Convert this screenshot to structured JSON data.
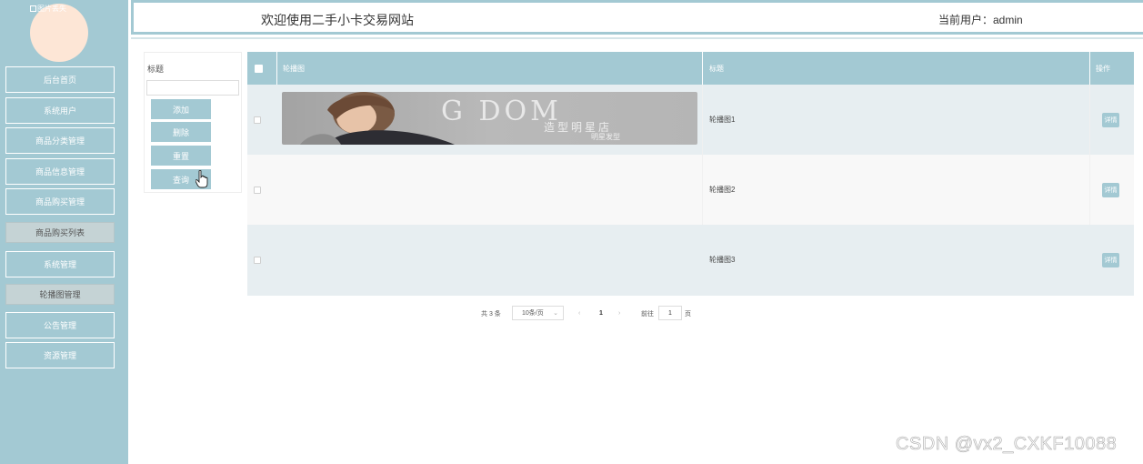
{
  "sidebar": {
    "avatar_alt": "图片丢失",
    "items": [
      {
        "label": "后台首页"
      },
      {
        "label": "系统用户"
      },
      {
        "label": "商品分类管理"
      },
      {
        "label": "商品信息管理"
      },
      {
        "label": "商品购买管理"
      },
      {
        "label": "商品购买列表"
      },
      {
        "label": "系统管理"
      },
      {
        "label": "轮播图管理"
      },
      {
        "label": "公告管理"
      },
      {
        "label": "资源管理"
      }
    ]
  },
  "header": {
    "title": "欢迎使用二手小卡交易网站",
    "current_user": "当前用户：admin"
  },
  "search": {
    "label": "标题",
    "placeholder": "",
    "buttons": {
      "add": "添加",
      "delete": "删除",
      "reset": "重置",
      "query": "查询"
    }
  },
  "table": {
    "columns": [
      "轮播图",
      "标题",
      "操作"
    ],
    "rows": [
      {
        "title": "轮播图1",
        "action": "详情"
      },
      {
        "title": "轮播图2",
        "action": "详情"
      },
      {
        "title": "轮播图3",
        "action": "详情"
      }
    ],
    "banner": {
      "text": "G DOM",
      "sub": "造型明星店",
      "sub2": "明星发型"
    }
  },
  "pagination": {
    "total": "共 3 条",
    "page_size": "10条/页",
    "prev": "‹",
    "current": "1",
    "next": "›",
    "goto_label": "前往",
    "goto_value": "1",
    "goto_suffix": "页"
  },
  "watermark": "CSDN @vx2_CXKF10088",
  "colors": {
    "accent": "#a3c9d3",
    "avatar": "#fde6d6",
    "row_alt": "#e7eef1"
  }
}
